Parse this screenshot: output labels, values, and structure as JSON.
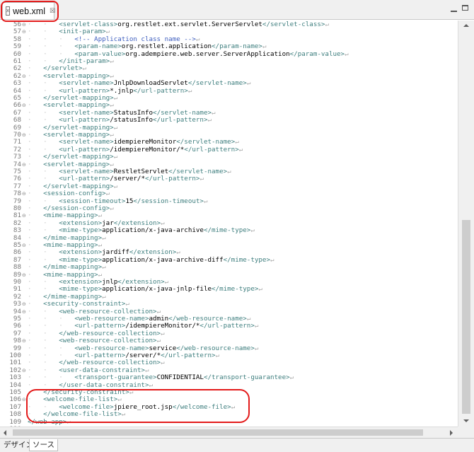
{
  "tab": {
    "title": "web.xml",
    "file_icon": "x",
    "close_glyph": "☒"
  },
  "bottom_tabs": {
    "design": "デザイン",
    "source": "ソース"
  },
  "eol_marker": "↵",
  "lines": [
    {
      "n": "56",
      "fold": "⊖",
      "indent": 1,
      "text": "<servlet-class>org.restlet.ext.servlet.ServerServlet</servlet-class>"
    },
    {
      "n": "57",
      "fold": "⊖",
      "indent": 1,
      "text": "<init-param>"
    },
    {
      "n": "58",
      "fold": "",
      "indent": 2,
      "text": "<!-- Application class name -->"
    },
    {
      "n": "59",
      "fold": "",
      "indent": 2,
      "text": "<param-name>org.restlet.application</param-name>"
    },
    {
      "n": "60",
      "fold": "",
      "indent": 2,
      "text": "<param-value>org.adempiere.web.server.ServerApplication</param-value>"
    },
    {
      "n": "61",
      "fold": "",
      "indent": 1,
      "text": "</init-param>"
    },
    {
      "n": "62",
      "fold": "",
      "indent": 0,
      "text": "</servlet>"
    },
    {
      "n": "62",
      "fold": "⊖",
      "indent": 0,
      "text": "<servlet-mapping>"
    },
    {
      "n": "63",
      "fold": "",
      "indent": 1,
      "text": "<servlet-name>JnlpDownloadServlet</servlet-name>"
    },
    {
      "n": "64",
      "fold": "",
      "indent": 1,
      "text": "<url-pattern>*.jnlp</url-pattern>"
    },
    {
      "n": "65",
      "fold": "",
      "indent": 0,
      "text": "</servlet-mapping>"
    },
    {
      "n": "66",
      "fold": "⊖",
      "indent": 0,
      "text": "<servlet-mapping>"
    },
    {
      "n": "67",
      "fold": "",
      "indent": 1,
      "text": "<servlet-name>StatusInfo</servlet-name>"
    },
    {
      "n": "68",
      "fold": "",
      "indent": 1,
      "text": "<url-pattern>/statusInfo</url-pattern>"
    },
    {
      "n": "69",
      "fold": "",
      "indent": 0,
      "text": "</servlet-mapping>"
    },
    {
      "n": "70",
      "fold": "⊖",
      "indent": 0,
      "text": "<servlet-mapping>"
    },
    {
      "n": "71",
      "fold": "",
      "indent": 1,
      "text": "<servlet-name>idempiereMonitor</servlet-name>"
    },
    {
      "n": "72",
      "fold": "",
      "indent": 1,
      "text": "<url-pattern>/idempiereMonitor/*</url-pattern>"
    },
    {
      "n": "73",
      "fold": "",
      "indent": 0,
      "text": "</servlet-mapping>"
    },
    {
      "n": "74",
      "fold": "⊖",
      "indent": 0,
      "text": "<servlet-mapping>"
    },
    {
      "n": "75",
      "fold": "",
      "indent": 1,
      "text": "<servlet-name>RestletServlet</servlet-name>"
    },
    {
      "n": "76",
      "fold": "",
      "indent": 1,
      "text": "<url-pattern>/server/*</url-pattern>"
    },
    {
      "n": "77",
      "fold": "",
      "indent": 0,
      "text": "</servlet-mapping>"
    },
    {
      "n": "78",
      "fold": "⊖",
      "indent": 0,
      "text": "<session-config>"
    },
    {
      "n": "79",
      "fold": "",
      "indent": 1,
      "text": "<session-timeout>15</session-timeout>"
    },
    {
      "n": "80",
      "fold": "",
      "indent": 0,
      "text": "</session-config>"
    },
    {
      "n": "81",
      "fold": "⊖",
      "indent": 0,
      "text": "<mime-mapping>"
    },
    {
      "n": "82",
      "fold": "",
      "indent": 1,
      "text": "<extension>jar</extension>"
    },
    {
      "n": "83",
      "fold": "",
      "indent": 1,
      "text": "<mime-type>application/x-java-archive</mime-type>"
    },
    {
      "n": "84",
      "fold": "",
      "indent": 0,
      "text": "</mime-mapping>"
    },
    {
      "n": "85",
      "fold": "⊖",
      "indent": 0,
      "text": "<mime-mapping>"
    },
    {
      "n": "86",
      "fold": "",
      "indent": 1,
      "text": "<extension>jardiff</extension>"
    },
    {
      "n": "87",
      "fold": "",
      "indent": 1,
      "text": "<mime-type>application/x-java-archive-diff</mime-type>"
    },
    {
      "n": "88",
      "fold": "",
      "indent": 0,
      "text": "</mime-mapping>"
    },
    {
      "n": "89",
      "fold": "⊖",
      "indent": 0,
      "text": "<mime-mapping>"
    },
    {
      "n": "90",
      "fold": "",
      "indent": 1,
      "text": "<extension>jnlp</extension>"
    },
    {
      "n": "91",
      "fold": "",
      "indent": 1,
      "text": "<mime-type>application/x-java-jnlp-file</mime-type>"
    },
    {
      "n": "92",
      "fold": "",
      "indent": 0,
      "text": "</mime-mapping>"
    },
    {
      "n": "93",
      "fold": "⊖",
      "indent": 0,
      "text": "<security-constraint>"
    },
    {
      "n": "94",
      "fold": "⊖",
      "indent": 1,
      "text": "<web-resource-collection>"
    },
    {
      "n": "95",
      "fold": "",
      "indent": 2,
      "text": "<web-resource-name>admin</web-resource-name>"
    },
    {
      "n": "96",
      "fold": "",
      "indent": 2,
      "text": "<url-pattern>/idempiereMonitor/*</url-pattern>"
    },
    {
      "n": "97",
      "fold": "",
      "indent": 1,
      "text": "</web-resource-collection>"
    },
    {
      "n": "98",
      "fold": "⊖",
      "indent": 1,
      "text": "<web-resource-collection>"
    },
    {
      "n": "99",
      "fold": "",
      "indent": 2,
      "text": "<web-resource-name>service</web-resource-name>"
    },
    {
      "n": "100",
      "fold": "",
      "indent": 2,
      "text": "<url-pattern>/server/*</url-pattern>"
    },
    {
      "n": "101",
      "fold": "",
      "indent": 1,
      "text": "</web-resource-collection>"
    },
    {
      "n": "102",
      "fold": "⊖",
      "indent": 1,
      "text": "<user-data-constraint>"
    },
    {
      "n": "103",
      "fold": "",
      "indent": 2,
      "text": "<transport-guarantee>CONFIDENTIAL</transport-guarantee>"
    },
    {
      "n": "104",
      "fold": "",
      "indent": 1,
      "text": "</user-data-constraint>"
    },
    {
      "n": "105",
      "fold": "",
      "indent": 0,
      "text": "</security-constraint>"
    },
    {
      "n": "106",
      "fold": "⊖",
      "indent": 0,
      "text": "<welcome-file-list>"
    },
    {
      "n": "107",
      "fold": "",
      "indent": 1,
      "text": "<welcome-file>jpiere_root.jsp</welcome-file>"
    },
    {
      "n": "108",
      "fold": "",
      "indent": 0,
      "text": "</welcome-file-list>"
    },
    {
      "n": "109",
      "fold": "",
      "indent": -1,
      "text": "</web-app>"
    },
    {
      "n": "110",
      "fold": "",
      "indent": -1,
      "text": ""
    }
  ]
}
